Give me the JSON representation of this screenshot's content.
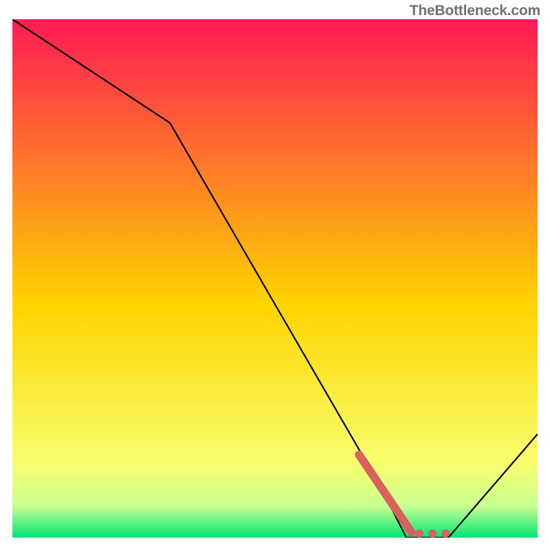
{
  "watermark": "TheBottleneck.com",
  "colors": {
    "top": "#ff1a54",
    "mid": "#ffd400",
    "band1": "#f7ff6e",
    "band2": "#c7ff91",
    "bottom": "#00e676",
    "curve": "#000000",
    "highlight": "#d7625e"
  },
  "chart_data": {
    "type": "line",
    "title": "",
    "xlabel": "",
    "ylabel": "",
    "xlim": [
      0,
      100
    ],
    "ylim": [
      0,
      100
    ],
    "x": [
      0,
      30,
      70,
      75,
      83,
      100
    ],
    "values": [
      100,
      80,
      10,
      0,
      0,
      20
    ],
    "highlight": {
      "x": [
        66,
        76,
        77.5,
        80,
        82.5
      ],
      "values": [
        16,
        1,
        0.8,
        0.8,
        0.8
      ]
    },
    "notes": "y=100 at top of gradient (red), y=0 at bottom (green). Curve has a knee near x≈30, descends steeply to a flat valley ~x 75–83, then rises toward x=100."
  }
}
